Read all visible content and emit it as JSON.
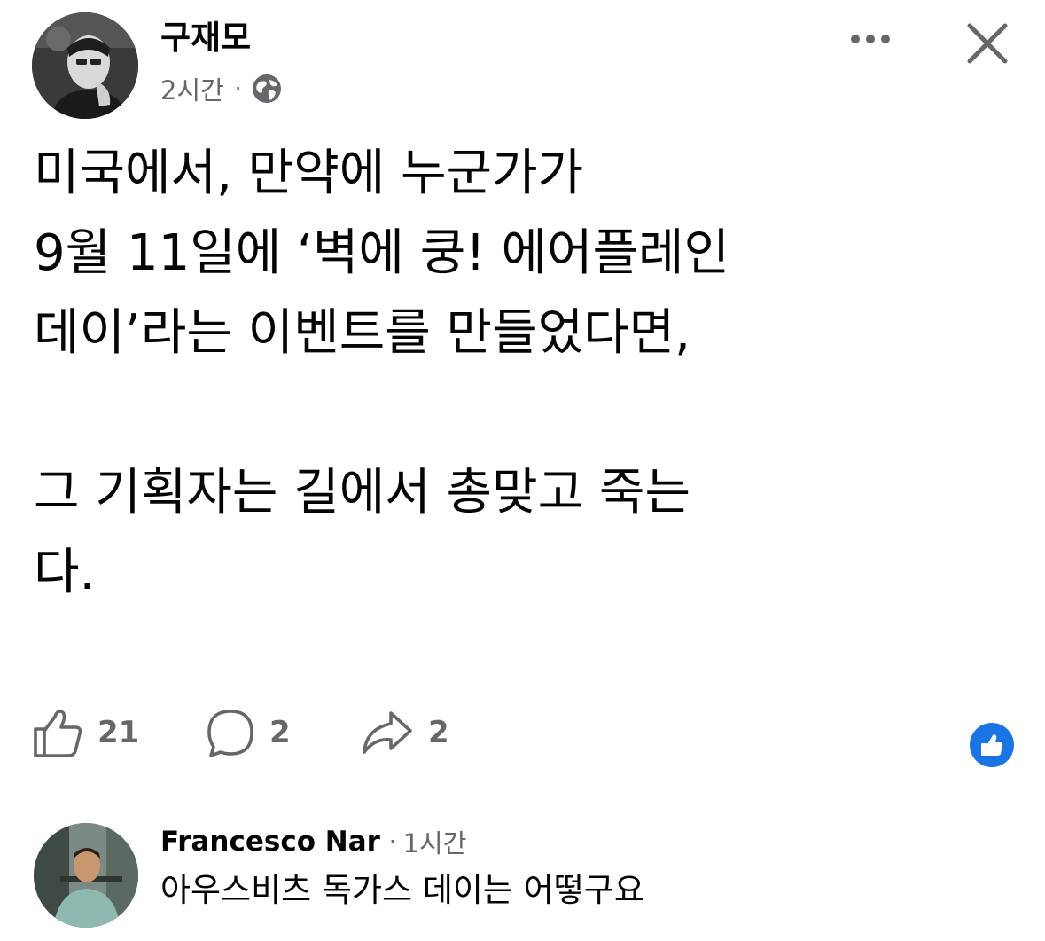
{
  "post": {
    "author_name": "구재모",
    "timestamp": "2시간",
    "separator": "·",
    "audience_icon": "globe-icon",
    "text": "미국에서, 만약에 누군가가\n9월 11일에 ‘벽에 쿵! 에어플레인\n데이’라는 이벤트를 만들었다면,\n\n그 기획자는 길에서 총맞고 죽는\n다."
  },
  "header_actions": {
    "more_icon": "more-options-icon",
    "close_icon": "close-icon"
  },
  "actions": {
    "like_count": "21",
    "comment_count": "2",
    "share_count": "2"
  },
  "reaction_badge": {
    "icon": "thumbs-up-reaction-icon",
    "color": "#1b74e4"
  },
  "comment": {
    "author_name": "Francesco Nar",
    "separator": "·",
    "timestamp": "1시간",
    "text": "아우스비츠 독가스 데이는 어떻구요"
  },
  "colors": {
    "text_primary": "#050505",
    "text_secondary": "#65676b",
    "accent": "#1b74e4"
  }
}
